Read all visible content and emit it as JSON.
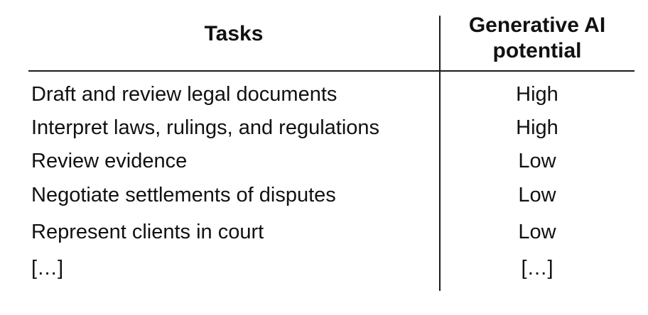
{
  "table": {
    "headers": {
      "tasks": "Tasks",
      "potential": "Generative AI potential"
    },
    "rows": [
      {
        "task": "Draft and review legal documents",
        "potential": "High"
      },
      {
        "task": "Interpret laws, rulings, and regulations",
        "potential": "High"
      },
      {
        "task": "Review evidence",
        "potential": "Low"
      },
      {
        "task": "Negotiate settlements of disputes",
        "potential": "Low"
      },
      {
        "task": "Represent clients in court",
        "potential": "Low"
      },
      {
        "task": "[…]",
        "potential": "[…]"
      }
    ]
  }
}
